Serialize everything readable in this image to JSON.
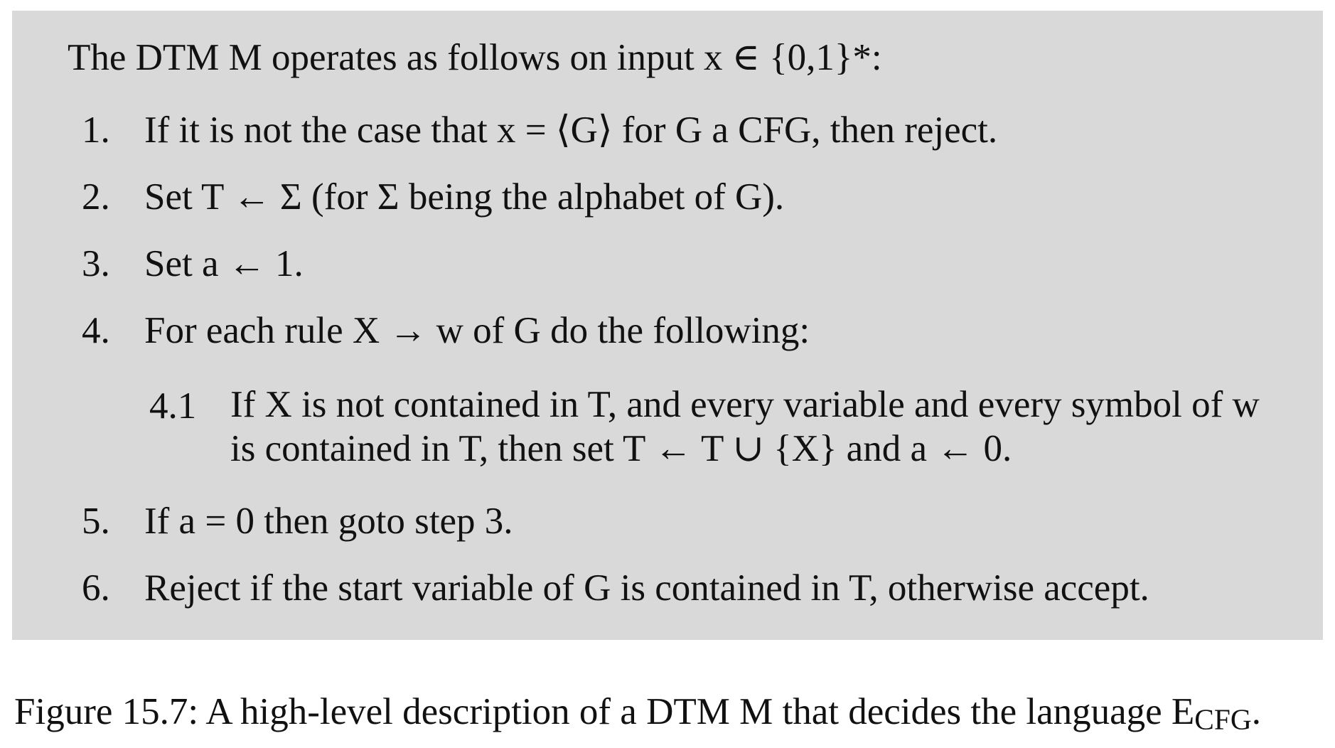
{
  "intro": "The DTM M operates as follows on input x ∈ {0,1}*:",
  "steps": [
    {
      "num": "1.",
      "text": "If it is not the case that x = ⟨G⟩ for G a CFG, then reject."
    },
    {
      "num": "2.",
      "text": "Set T ← Σ (for Σ being the alphabet of G)."
    },
    {
      "num": "3.",
      "text": "Set a ← 1."
    },
    {
      "num": "4.",
      "text": "For each rule X → w of G do the following:"
    },
    {
      "num": "4.1",
      "text": "If X is not contained in T, and every variable and every symbol of w is contained in T, then set T ← T ∪ {X} and a ← 0."
    },
    {
      "num": "5.",
      "text": "If a = 0 then goto step 3."
    },
    {
      "num": "6.",
      "text": "Reject if the start variable of G is contained in T, otherwise accept."
    }
  ],
  "caption": {
    "text": "Figure 15.7: A high-level description of a DTM M that decides the language E",
    "subscript": "CFG",
    "end": "."
  }
}
